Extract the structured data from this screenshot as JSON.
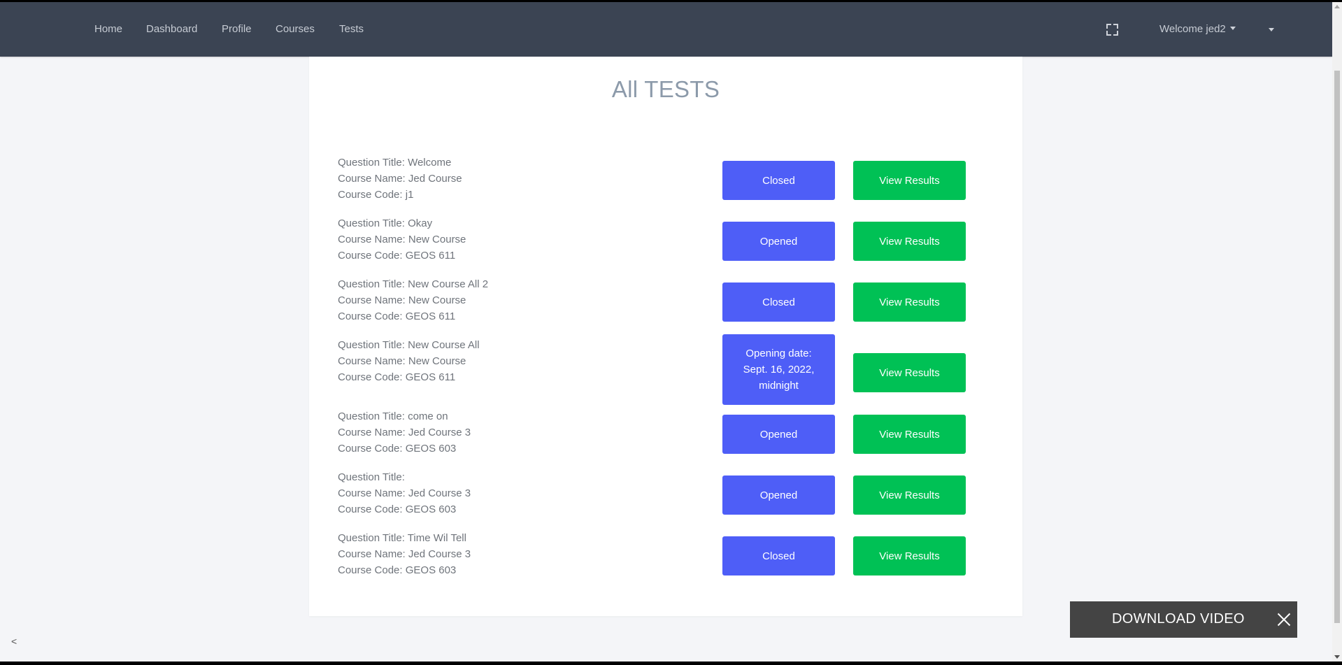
{
  "navbar": {
    "links": [
      "Home",
      "Dashboard",
      "Profile",
      "Courses",
      "Tests"
    ],
    "fullscreen_icon": "fullscreen-icon",
    "user_menu_label": "Welcome jed2"
  },
  "page": {
    "title": "All TESTS"
  },
  "labels": {
    "question_title": "Question Title:",
    "course_name": "Course Name:",
    "course_code": "Course Code:"
  },
  "tests": [
    {
      "question_title": "Welcome",
      "course_name": "Jed Course",
      "course_code": "j1",
      "status": "Closed",
      "results_label": "View Results"
    },
    {
      "question_title": "Okay",
      "course_name": "New Course",
      "course_code": "GEOS 611",
      "status": "Opened",
      "results_label": "View Results"
    },
    {
      "question_title": "New Course All 2",
      "course_name": "New Course",
      "course_code": "GEOS 611",
      "status": "Closed",
      "results_label": "View Results"
    },
    {
      "question_title": "New Course All",
      "course_name": "New Course",
      "course_code": "GEOS 611",
      "status": "Opening date: Sept. 16, 2022, midnight",
      "results_label": "View Results"
    },
    {
      "question_title": "come on",
      "course_name": "Jed Course 3",
      "course_code": "GEOS 603",
      "status": "Opened",
      "results_label": "View Results"
    },
    {
      "question_title": "",
      "course_name": "Jed Course 3",
      "course_code": "GEOS 603",
      "status": "Opened",
      "results_label": "View Results"
    },
    {
      "question_title": "Time Wil Tell",
      "course_name": "Jed Course 3",
      "course_code": "GEOS 603",
      "status": "Closed",
      "results_label": "View Results"
    }
  ],
  "download_video": {
    "label": "DOWNLOAD VIDEO",
    "close_icon": "close-icon"
  },
  "sidebar_toggle": "<",
  "colors": {
    "navbar_bg": "#3b4453",
    "status_button": "#4e5ef7",
    "results_button": "#00c155",
    "page_bg": "#f4f5f8",
    "title_color": "#8c9aaa"
  }
}
